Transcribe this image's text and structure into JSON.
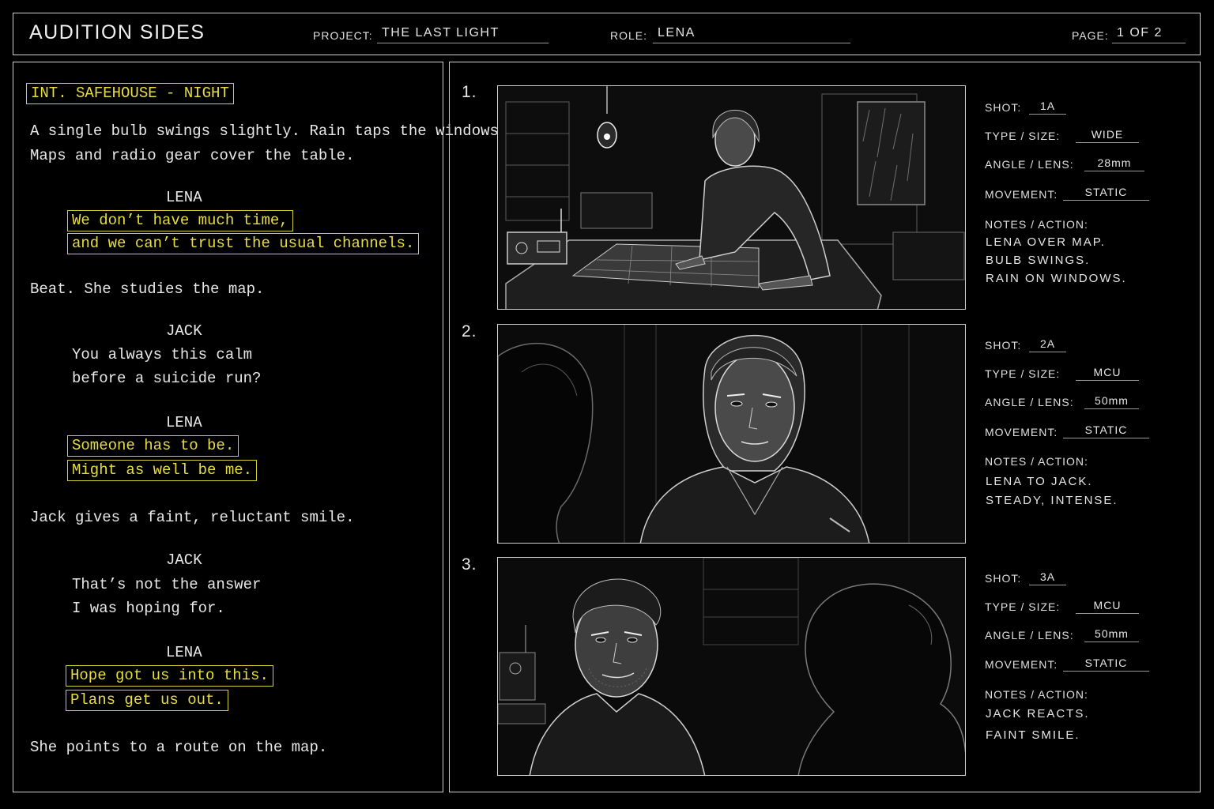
{
  "header": {
    "title": "AUDITION SIDES",
    "project_label": "PROJECT:",
    "project_value": "THE LAST LIGHT",
    "role_label": "ROLE:",
    "role_value": "LENA",
    "page_label": "PAGE:",
    "page_value": "1 OF 2"
  },
  "script": {
    "slugline": "INT. SAFEHOUSE - NIGHT",
    "action_1": [
      "A single bulb swings slightly. Rain taps the windows.",
      "Maps and radio gear cover the table."
    ],
    "cue_1": "LENA",
    "dialogue_1": [
      "We don’t have much time,",
      "and we can’t trust the usual channels."
    ],
    "action_2": "Beat. She studies the map.",
    "cue_2": "JACK",
    "dialogue_2": [
      "You always this calm",
      "before a suicide run?"
    ],
    "cue_3": "LENA",
    "dialogue_3": [
      "Someone has to be.",
      "Might as well be me."
    ],
    "action_3": "Jack gives a faint, reluctant smile.",
    "cue_4": "JACK",
    "dialogue_4": [
      "That’s not the answer",
      "I was hoping for."
    ],
    "cue_5": "LENA",
    "dialogue_5": [
      "Hope got us into this.",
      "Plans get us out."
    ],
    "action_4": "She points to a route on the map."
  },
  "labels": {
    "shot": "SHOT:",
    "type_size": "TYPE / SIZE:",
    "angle_lens": "ANGLE / LENS:",
    "movement": "MOVEMENT:",
    "notes_action": "NOTES / ACTION:"
  },
  "shots": [
    {
      "number": "1.",
      "shot": "1A",
      "type": "WIDE",
      "lens": "28mm",
      "movement": "STATIC",
      "notes": [
        "LENA OVER MAP.",
        "BULB SWINGS.",
        "RAIN ON WINDOWS."
      ]
    },
    {
      "number": "2.",
      "shot": "2A",
      "type": "MCU",
      "lens": "50mm",
      "movement": "STATIC",
      "notes": [
        "LENA TO JACK.",
        "STEADY, INTENSE."
      ]
    },
    {
      "number": "3.",
      "shot": "3A",
      "type": "MCU",
      "lens": "50mm",
      "movement": "STATIC",
      "notes": [
        "JACK REACTS.",
        "FAINT SMILE."
      ]
    }
  ],
  "colors": {
    "background": "#000000",
    "line": "#cfcfcf",
    "highlight": "#e8de3e"
  }
}
